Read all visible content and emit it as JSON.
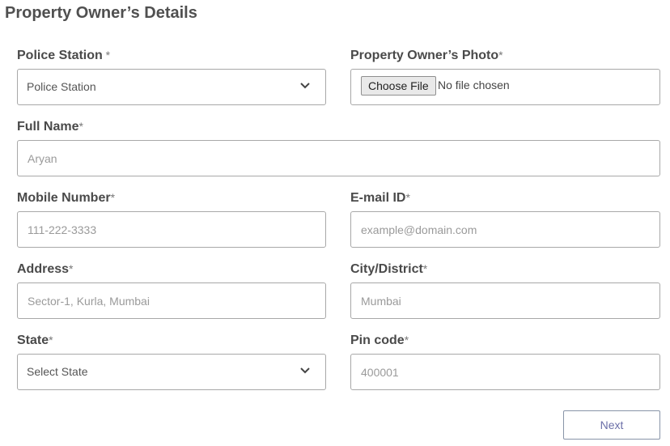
{
  "form": {
    "title": "Property Owner’s Details",
    "police_station": {
      "label": "Police Station",
      "required_mark": " *",
      "selected": "Police Station"
    },
    "photo": {
      "label": "Property Owner’s Photo",
      "required_mark": "*",
      "button_label": "Choose File",
      "status": "No file chosen"
    },
    "full_name": {
      "label": "Full Name",
      "required_mark": "*",
      "placeholder": "Aryan"
    },
    "mobile": {
      "label": "Mobile Number",
      "required_mark": "*",
      "placeholder": "111-222-3333"
    },
    "email": {
      "label": "E-mail ID",
      "required_mark": "*",
      "placeholder": "example@domain.com"
    },
    "address": {
      "label": "Address",
      "required_mark": "*",
      "placeholder": "Sector-1, Kurla, Mumbai"
    },
    "city": {
      "label": "City/District",
      "required_mark": "*",
      "placeholder": "Mumbai"
    },
    "state": {
      "label": "State",
      "required_mark": "*",
      "selected": "Select State"
    },
    "pincode": {
      "label": "Pin code",
      "required_mark": "*",
      "placeholder": "400001"
    },
    "next_label": "Next"
  },
  "icons": {
    "dropdown": "chevron-down-icon"
  }
}
